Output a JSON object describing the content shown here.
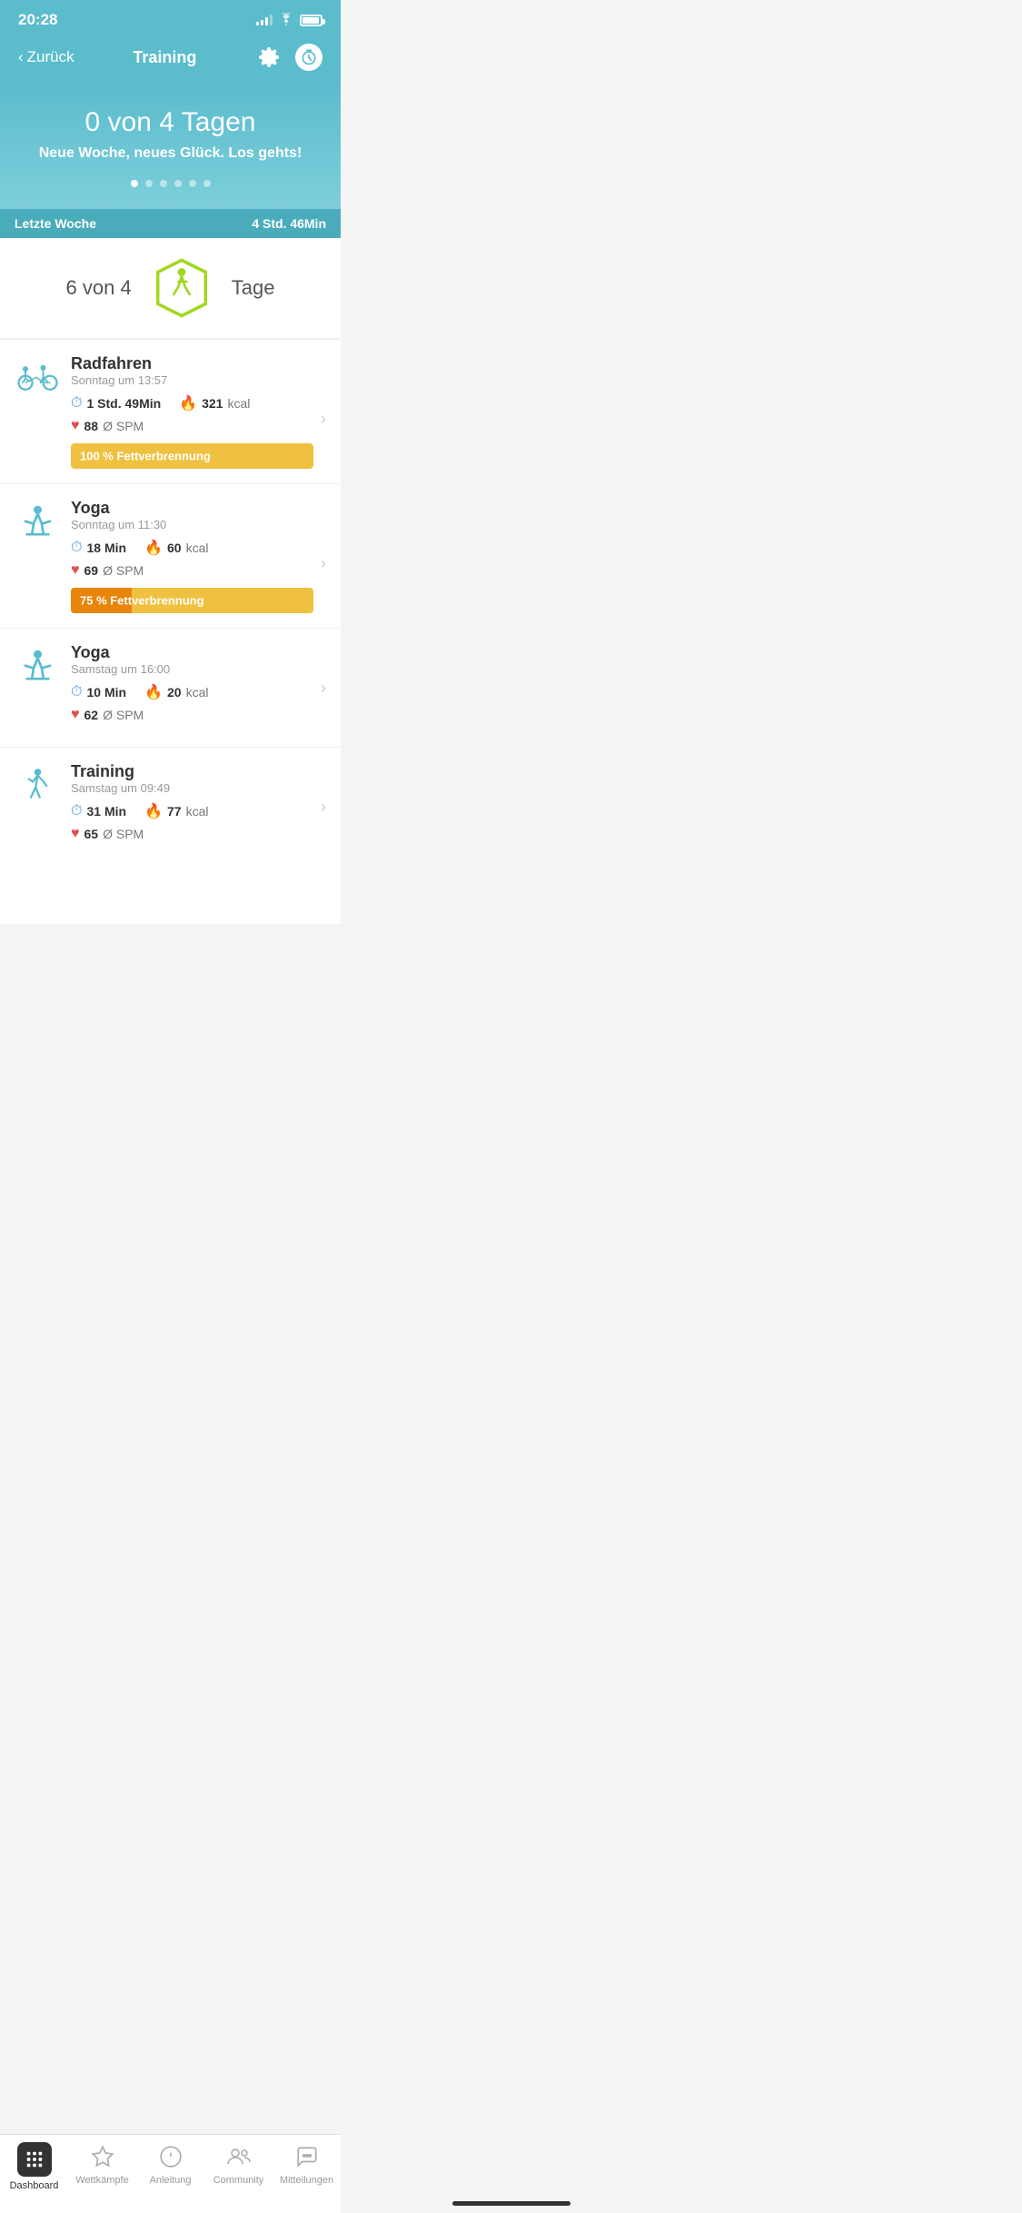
{
  "status": {
    "time": "20:28"
  },
  "nav": {
    "back_label": "Zurück",
    "title": "Training"
  },
  "hero": {
    "days_done": "0 von 4 Tagen",
    "subtitle": "Neue Woche, neues Glück. Los gehts!",
    "dots": [
      {
        "active": true
      },
      {
        "active": false
      },
      {
        "active": false
      },
      {
        "active": false
      },
      {
        "active": false
      },
      {
        "active": false
      }
    ]
  },
  "last_week": {
    "label": "Letzte Woche",
    "duration": "4 Std. 46Min"
  },
  "progress": {
    "current": "6 von 4",
    "label": "Tage"
  },
  "workouts": [
    {
      "name": "Radfahren",
      "time_str": "Sonntag um 13:57",
      "duration": "1 Std. 49Min",
      "kcal": "321",
      "heart": "88",
      "fat_pct": 100,
      "fat_label": "100 % Fettverbrennung",
      "type": "cycling"
    },
    {
      "name": "Yoga",
      "time_str": "Sonntag um 11:30",
      "duration": "18 Min",
      "kcal": "60",
      "heart": "69",
      "fat_pct": 75,
      "fat_label": "75 % Fettverbrennung",
      "type": "yoga"
    },
    {
      "name": "Yoga",
      "time_str": "Samstag um 16:00",
      "duration": "10 Min",
      "kcal": "20",
      "heart": "62",
      "fat_pct": null,
      "fat_label": null,
      "type": "yoga"
    },
    {
      "name": "Training",
      "time_str": "Samstag um 09:49",
      "duration": "31 Min",
      "kcal": "77",
      "heart": "65",
      "fat_pct": null,
      "fat_label": null,
      "type": "training"
    }
  ],
  "tabs": [
    {
      "label": "Dashboard",
      "icon": "grid",
      "active": true
    },
    {
      "label": "Wettkämpfe",
      "icon": "star",
      "active": false
    },
    {
      "label": "Anleitung",
      "icon": "compass",
      "active": false
    },
    {
      "label": "Community",
      "icon": "people",
      "active": false
    },
    {
      "label": "Mitteilungen",
      "icon": "chat",
      "active": false
    }
  ]
}
